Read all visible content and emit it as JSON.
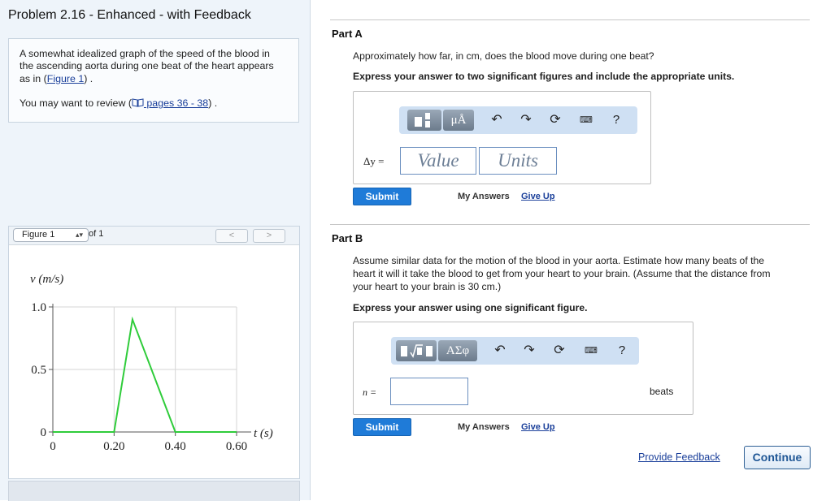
{
  "problem": {
    "title": "Problem 2.16 - Enhanced - with Feedback",
    "intro_line1": "A somewhat idealized graph of the speed of the blood in",
    "intro_line2": "the ascending aorta during one beat of the heart appears",
    "intro_line3_prefix": "as in (",
    "intro_figure_link": "Figure 1",
    "intro_line3_suffix": ") .",
    "review_prefix": "You may want to review (",
    "review_link": " pages 36 - 38",
    "review_suffix": ") ."
  },
  "figure_panel": {
    "selected_figure": "Figure 1",
    "of_text": "of 1",
    "prev_label": "<",
    "next_label": ">"
  },
  "chart_data": {
    "type": "line",
    "ylabel": "v (m/s)",
    "xlabel": "t (s)",
    "xlim": [
      0,
      0.6
    ],
    "ylim": [
      0,
      1.0
    ],
    "x_ticks": [
      "0",
      "0.20",
      "0.40",
      "0.60"
    ],
    "y_ticks": [
      "0",
      "0.5",
      "1.0"
    ],
    "grid": true,
    "series": [
      {
        "x": [
          0,
          0.2,
          0.26,
          0.4,
          0.6
        ],
        "y": [
          0,
          0,
          0.9,
          0,
          0
        ],
        "color": "#2fcc3a"
      }
    ]
  },
  "partA": {
    "title": "Part A",
    "question": "Approximately how far, in cm, does the blood move during one beat?",
    "instruction": "Express your answer to two significant figures and include the appropriate units.",
    "var_label": "Δy =",
    "value_placeholder": "Value",
    "units_placeholder": "Units",
    "toolbar_mu_label": "μÅ",
    "submit_label": "Submit",
    "my_answers_label": "My Answers",
    "give_up_label": "Give Up"
  },
  "partB": {
    "title": "Part B",
    "question_line1": "Assume similar data for the motion of the blood in your aorta. Estimate how many beats of the",
    "question_line2": "heart it will it take the blood to get from your heart to your brain. (Assume that the distance from",
    "question_line3": "your heart to your brain is 30 cm.)",
    "instruction": "Express your answer using one significant figure.",
    "var_label": "n =",
    "units_text": "beats",
    "toolbar_greek_label": "ΑΣφ",
    "submit_label": "Submit",
    "my_answers_label": "My Answers",
    "give_up_label": "Give Up"
  },
  "toolbar_help_label": "?",
  "footer": {
    "feedback_label": "Provide Feedback",
    "continue_label": "Continue"
  },
  "colors": {
    "accent_blue": "#1f7bd8",
    "link": "#1a3f9a",
    "plot_line": "#2fcc3a",
    "toolbar_bg": "#cfe0f3"
  }
}
